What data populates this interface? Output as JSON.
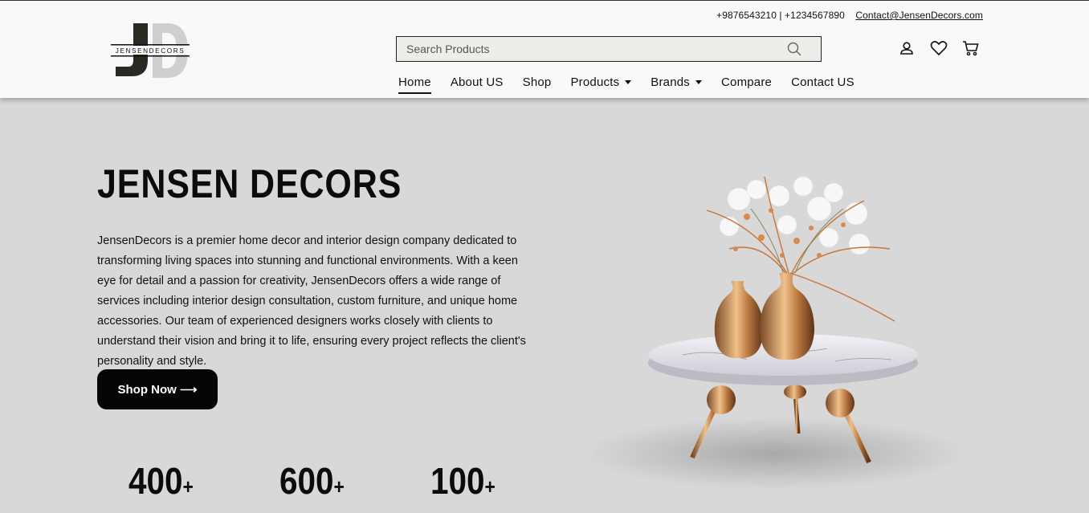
{
  "brand": {
    "logo_text": "JENSENDECORS"
  },
  "contact": {
    "phones": "+9876543210 | +1234567890",
    "email": "Contact@JensenDecors.com"
  },
  "search": {
    "placeholder": "Search Products"
  },
  "nav": {
    "items": [
      {
        "label": "Home",
        "active": true
      },
      {
        "label": "About US"
      },
      {
        "label": "Shop"
      },
      {
        "label": "Products",
        "dropdown": true
      },
      {
        "label": "Brands",
        "dropdown": true
      },
      {
        "label": "Compare"
      },
      {
        "label": "Contact US"
      }
    ]
  },
  "header_icons": [
    "user-icon",
    "heart-icon",
    "cart-icon"
  ],
  "hero": {
    "title": "JENSEN DECORS",
    "description": "JensenDecors is a premier home decor and interior design company dedicated to transforming living spaces into stunning and functional environments. With a keen eye for detail and a passion for creativity, JensenDecors offers a wide range of services including interior design consultation, custom furniture, and unique home accessories. Our team of experienced designers works closely with clients to understand their vision and bring it to life, ensuring every project reflects the client's personality and style.",
    "cta": "Shop Now ⟶"
  },
  "stats": [
    {
      "value": "400",
      "suffix": "+"
    },
    {
      "value": "600",
      "suffix": "+"
    },
    {
      "value": "100",
      "suffix": "+"
    }
  ],
  "colors": {
    "header_bg": "#f7f9fb",
    "page_bg": "#d8d8d8",
    "button_bg": "#050505",
    "accent_gold": "#c8894e"
  }
}
